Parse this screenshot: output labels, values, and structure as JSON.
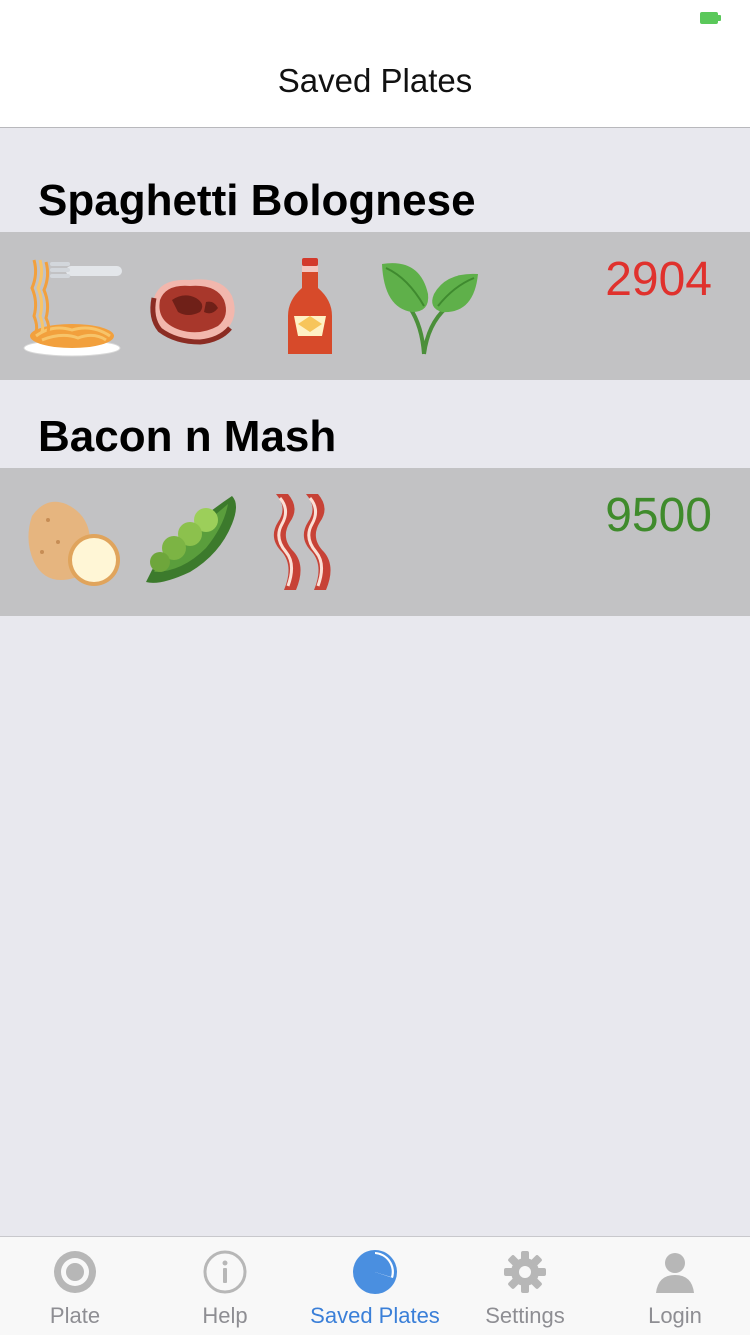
{
  "nav": {
    "title": "Saved Plates"
  },
  "plates": [
    {
      "name": "Spaghetti Bolognese",
      "score": "2904",
      "score_color": "#e0312d",
      "icons": [
        "spaghetti-icon",
        "steak-icon",
        "ketchup-icon",
        "herb-icon"
      ]
    },
    {
      "name": "Bacon n Mash",
      "score": "9500",
      "score_color": "#3f8b2c",
      "icons": [
        "potato-icon",
        "peas-icon",
        "bacon-icon"
      ]
    }
  ],
  "tabs": [
    {
      "label": "Plate",
      "icon": "target-icon",
      "active": false
    },
    {
      "label": "Help",
      "icon": "info-icon",
      "active": false
    },
    {
      "label": "Saved Plates",
      "icon": "pie-chart-icon",
      "active": true
    },
    {
      "label": "Settings",
      "icon": "gear-icon",
      "active": false
    },
    {
      "label": "Login",
      "icon": "user-icon",
      "active": false
    }
  ],
  "colors": {
    "accent": "#3a7fd8",
    "inactive": "#8e8e93",
    "row_background": "#c2c2c4",
    "page_background": "#e8e8ee"
  }
}
